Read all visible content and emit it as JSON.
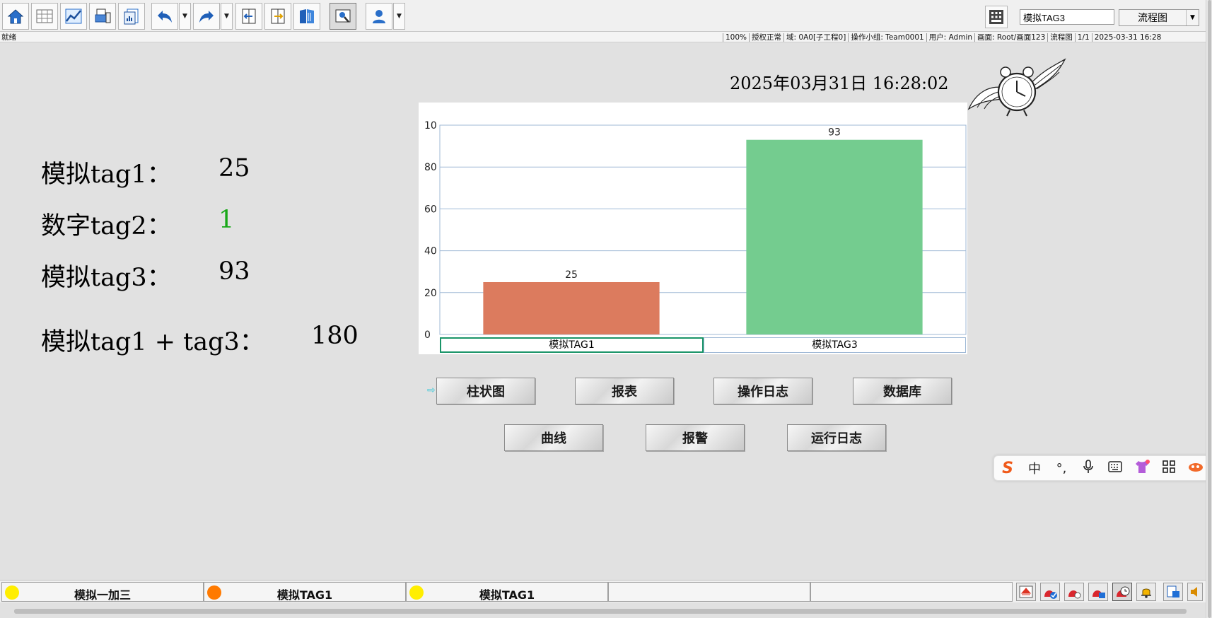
{
  "toolbar": {
    "search_value": "模拟TAG3",
    "view_select": "流程图"
  },
  "status": {
    "ready": "就绪",
    "zoom": "100%",
    "license": "授权正常",
    "domain": "域: 0A0[子工程0]",
    "group": "操作小组: Team0001",
    "user": "用户: Admin",
    "screen": "画面: Root/画面123",
    "view": "流程图",
    "page": "1/1",
    "clock": "2025-03-31 16:28"
  },
  "main": {
    "datetime": "2025年03月31日 16:28:02",
    "tag1_label": "模拟tag1：",
    "tag1_value": "25",
    "tag2_label": "数字tag2：",
    "tag2_value": "1",
    "tag3_label": "模拟tag3：",
    "tag3_value": "93",
    "sum_label": "模拟tag1 + tag3：",
    "sum_value": "180",
    "tag2_color": "#18a818"
  },
  "chart_data": {
    "type": "bar",
    "categories": [
      "模拟TAG1",
      "模拟TAG3"
    ],
    "values": [
      25,
      93
    ],
    "colors": [
      "#dc7b5e",
      "#74cc8f"
    ],
    "y_ticks": [
      "0",
      "20",
      "40",
      "60",
      "80",
      "10"
    ],
    "ylim": [
      0,
      100
    ],
    "grid": true,
    "legend": "bottom"
  },
  "nav": {
    "bar_chart": "柱状图",
    "report": "报表",
    "op_log": "操作日志",
    "database": "数据库",
    "curve": "曲线",
    "alarm": "报警",
    "run_log": "运行日志"
  },
  "ime": {
    "lang": "中",
    "punct": "°,"
  },
  "alarmbar": {
    "cells": [
      {
        "text": "模拟一加三",
        "dot": "#ffee00"
      },
      {
        "text": "模拟TAG1",
        "dot": "#ff7a00"
      },
      {
        "text": "模拟TAG1",
        "dot": "#ffee00"
      }
    ]
  }
}
